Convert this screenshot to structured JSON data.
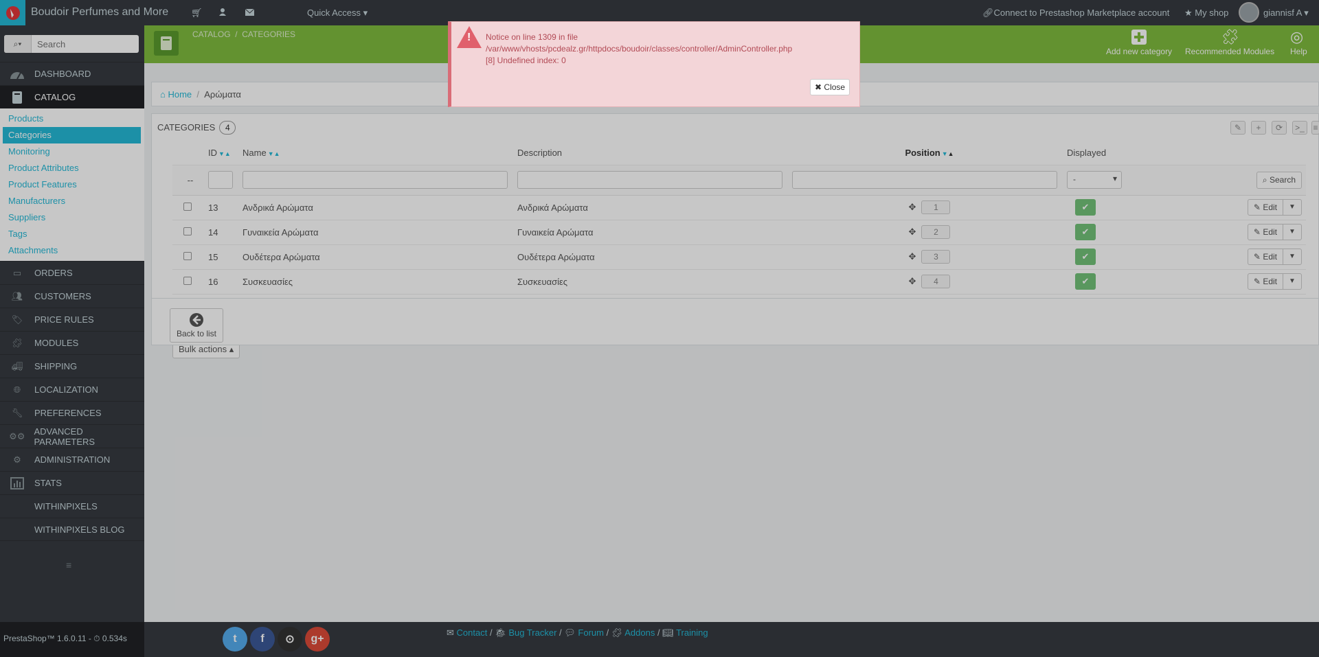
{
  "topbar": {
    "shop_name": "Boudoir Perfumes and More",
    "quick_access": "Quick Access",
    "connect": "Connect to Prestashop Marketplace account",
    "my_shop": "My shop",
    "user": "giannisf A"
  },
  "sidebar": {
    "search_placeholder": "Search",
    "items_top": [
      {
        "label": "DASHBOARD",
        "icon": "dashboard-icon"
      },
      {
        "label": "CATALOG",
        "icon": "book-icon"
      }
    ],
    "catalog_sub": [
      "Products",
      "Categories",
      "Monitoring",
      "Product Attributes",
      "Product Features",
      "Manufacturers",
      "Suppliers",
      "Tags",
      "Attachments"
    ],
    "items_bottom": [
      {
        "label": "ORDERS",
        "icon": "credit-card-icon"
      },
      {
        "label": "CUSTOMERS",
        "icon": "users-icon"
      },
      {
        "label": "PRICE RULES",
        "icon": "tags-icon"
      },
      {
        "label": "MODULES",
        "icon": "puzzle-icon"
      },
      {
        "label": "SHIPPING",
        "icon": "truck-icon"
      },
      {
        "label": "LOCALIZATION",
        "icon": "globe-icon"
      },
      {
        "label": "PREFERENCES",
        "icon": "wrench-icon"
      },
      {
        "label": "ADVANCED PARAMETERS",
        "icon": "cogs-icon"
      },
      {
        "label": "ADMINISTRATION",
        "icon": "gear-icon"
      },
      {
        "label": "STATS",
        "icon": "bar-chart-icon"
      },
      {
        "label": "WITHINPIXELS",
        "icon": ""
      },
      {
        "label": "WITHINPIXELS BLOG",
        "icon": ""
      }
    ],
    "version": "PrestaShop™ 1.6.0.11 - ⏱ 0.534s"
  },
  "header": {
    "crumb1": "CATALOG",
    "crumb2": "CATEGORIES",
    "add_new": "Add new category",
    "recommended": "Recommended Modules",
    "help": "Help"
  },
  "breadcrumb": {
    "home": "Home",
    "current": "Αρώματα"
  },
  "list": {
    "title": "CATEGORIES",
    "count": "4",
    "columns": {
      "id": "ID",
      "name": "Name",
      "description": "Description",
      "position": "Position",
      "displayed": "Displayed"
    },
    "filter_reset": "--",
    "displayed_select": "-",
    "search_button": "Search",
    "rows": [
      {
        "id": "13",
        "name": "Ανδρικά Αρώματα",
        "description": "Ανδρικά Αρώματα",
        "position": "1"
      },
      {
        "id": "14",
        "name": "Γυναικεία Αρώματα",
        "description": "Γυναικεία Αρώματα",
        "position": "2"
      },
      {
        "id": "15",
        "name": "Ουδέτερα Αρώματα",
        "description": "Ουδέτερα Αρώματα",
        "position": "3"
      },
      {
        "id": "16",
        "name": "Συσκευασίες",
        "description": "Συσκευασίες",
        "position": "4"
      }
    ],
    "edit_label": "Edit",
    "bulk_actions": "Bulk actions"
  },
  "back_to_list": "Back to list",
  "footer": {
    "contact": "Contact",
    "bug_tracker": "Bug Tracker",
    "forum": "Forum",
    "addons": "Addons",
    "training": "Training"
  },
  "alert": {
    "line1": "Notice on line 1309 in file",
    "line2": "/var/www/vhosts/pcdealz.gr/httpdocs/boudoir/classes/controller/AdminController.php",
    "line3": "[8] Undefined index: 0",
    "close": "Close"
  },
  "colors": {
    "accent": "#25b9d7",
    "header_green": "#7fbc3e",
    "sidebar": "#363a41",
    "alert_bg": "#f3d5d8"
  }
}
